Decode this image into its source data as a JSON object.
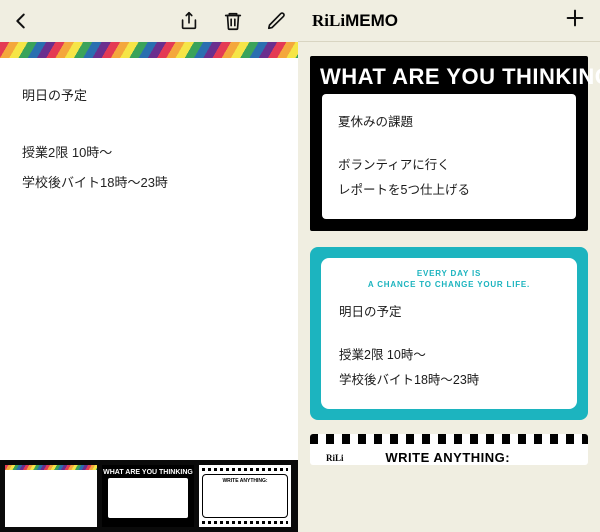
{
  "brand": {
    "rili": "RiLi",
    "memo": "MEMO"
  },
  "left_note": {
    "title": "明日の予定",
    "lines": [
      "授業2限 10時〜",
      "学校後バイト18時〜23時"
    ]
  },
  "thumbs": {
    "think_label": "WHAT ARE YOU THINKING",
    "write_label": "WRITE ANYTHING:"
  },
  "cards": {
    "think": {
      "headline": "WHAT ARE YOU THINKING",
      "title": "夏休みの課題",
      "lines": [
        "ボランティアに行く",
        "レポートを5つ仕上げる"
      ]
    },
    "teal": {
      "motto_l1": "EVERY DAY IS",
      "motto_l2": "A CHANCE TO CHANGE YOUR LIFE.",
      "title": "明日の予定",
      "lines": [
        "授業2限 10時〜",
        "学校後バイト18時〜23時"
      ]
    },
    "write": {
      "brand": "RiLi",
      "label": "WRITE ANYTHING:"
    }
  }
}
